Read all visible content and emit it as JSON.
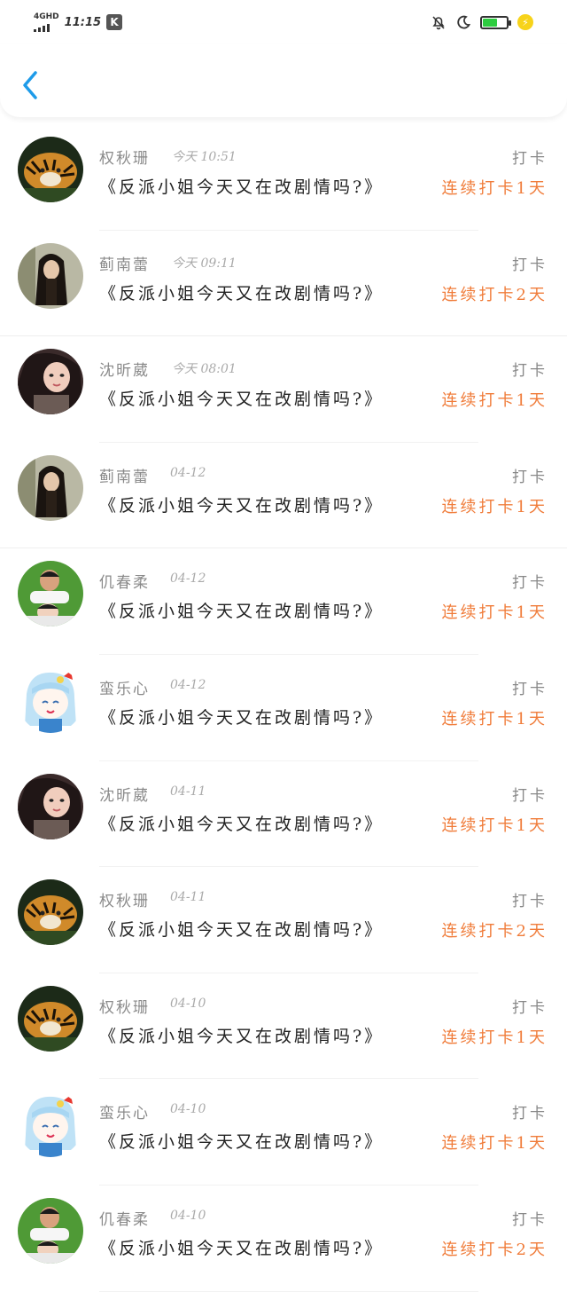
{
  "status_bar": {
    "network": "4GHD",
    "time": "11:15",
    "app_badge": "K"
  },
  "header": {
    "back_icon": "chevron-left-icon",
    "accent_color": "#1e9be9"
  },
  "list": {
    "action_label": "打卡",
    "items": [
      {
        "name": "权秋珊",
        "date": "今天 10:51",
        "book": "《反派小姐今天又在改剧情吗?》",
        "streak": "连续打卡1天",
        "avatar": "tiger"
      },
      {
        "name": "蓟南蕾",
        "date": "今天 09:11",
        "book": "《反派小姐今天又在改剧情吗?》",
        "streak": "连续打卡2天",
        "avatar": "girl-longhair"
      },
      {
        "name": "沈昕葳",
        "date": "今天 08:01",
        "book": "《反派小姐今天又在改剧情吗?》",
        "streak": "连续打卡1天",
        "avatar": "woman-selfie"
      },
      {
        "name": "蓟南蕾",
        "date": "04-12",
        "book": "《反派小姐今天又在改剧情吗?》",
        "streak": "连续打卡1天",
        "avatar": "girl-longhair"
      },
      {
        "name": "仉春柔",
        "date": "04-12",
        "book": "《反派小姐今天又在改剧情吗?》",
        "streak": "连续打卡1天",
        "avatar": "couple"
      },
      {
        "name": "蛮乐心",
        "date": "04-12",
        "book": "《反派小姐今天又在改剧情吗?》",
        "streak": "连续打卡1天",
        "avatar": "anime"
      },
      {
        "name": "沈昕葳",
        "date": "04-11",
        "book": "《反派小姐今天又在改剧情吗?》",
        "streak": "连续打卡1天",
        "avatar": "woman-selfie"
      },
      {
        "name": "权秋珊",
        "date": "04-11",
        "book": "《反派小姐今天又在改剧情吗?》",
        "streak": "连续打卡2天",
        "avatar": "tiger"
      },
      {
        "name": "权秋珊",
        "date": "04-10",
        "book": "《反派小姐今天又在改剧情吗?》",
        "streak": "连续打卡1天",
        "avatar": "tiger"
      },
      {
        "name": "蛮乐心",
        "date": "04-10",
        "book": "《反派小姐今天又在改剧情吗?》",
        "streak": "连续打卡1天",
        "avatar": "anime"
      },
      {
        "name": "仉春柔",
        "date": "04-10",
        "book": "《反派小姐今天又在改剧情吗?》",
        "streak": "连续打卡2天",
        "avatar": "couple"
      }
    ]
  }
}
